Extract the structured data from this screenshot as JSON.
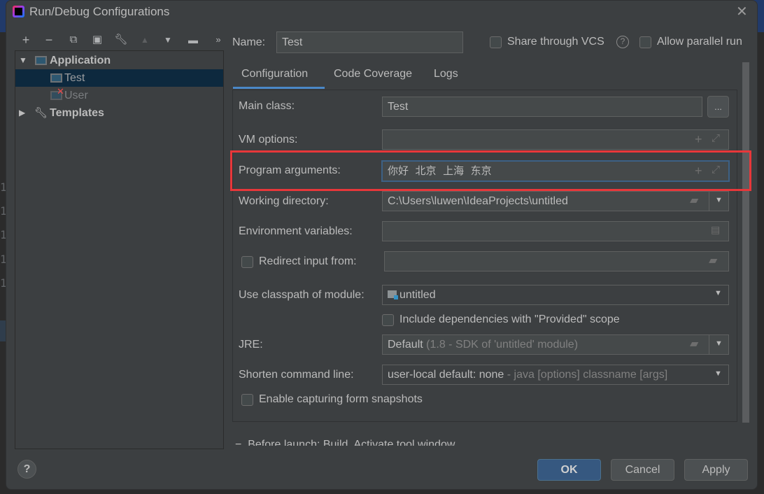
{
  "window": {
    "title": "Run/Debug Configurations"
  },
  "toolbar": {
    "icons": [
      "plus-icon",
      "minus-icon",
      "copy-icon",
      "save-icon",
      "wrench-icon",
      "arrow-up-icon",
      "arrow-down-icon",
      "folder-add-icon",
      "more-icon"
    ],
    "more": "»"
  },
  "tree": {
    "application": "Application",
    "items": [
      {
        "label": "Test",
        "selected": true
      },
      {
        "label": "User",
        "error": true
      }
    ],
    "templates": "Templates"
  },
  "name": {
    "label": "Name:",
    "value": "Test"
  },
  "share_vcs": {
    "label": "Share through VCS",
    "checked": false
  },
  "allow_parallel": {
    "label": "Allow parallel run",
    "checked": false
  },
  "tabs": [
    {
      "label": "Configuration",
      "active": true
    },
    {
      "label": "Code Coverage"
    },
    {
      "label": "Logs"
    }
  ],
  "form": {
    "main_class": {
      "label": "Main class:",
      "value": "Test",
      "browse": "..."
    },
    "vm_options": {
      "label": "VM options:",
      "value": ""
    },
    "program_arguments": {
      "label": "Program arguments:",
      "value": "你好  北京  上海  东京"
    },
    "working_directory": {
      "label": "Working directory:",
      "value": "C:\\Users\\luwen\\IdeaProjects\\untitled"
    },
    "environment_variables": {
      "label": "Environment variables:",
      "value": ""
    },
    "redirect_input": {
      "label": "Redirect input from:",
      "checked": false,
      "value": ""
    },
    "classpath_module": {
      "label": "Use classpath of module:",
      "value": "untitled"
    },
    "include_provided": {
      "label": "Include dependencies with \"Provided\" scope",
      "checked": false
    },
    "jre": {
      "label": "JRE:",
      "value": "Default",
      "hint": "(1.8 - SDK of 'untitled' module)"
    },
    "shorten_command_line": {
      "label": "Shorten command line:",
      "value": "user-local default: none",
      "hint": "- java [options] classname [args]"
    },
    "capture_snapshots": {
      "label": "Enable capturing form snapshots",
      "checked": false
    }
  },
  "before_launch": "Before launch: Build, Activate tool window",
  "buttons": {
    "ok": "OK",
    "cancel": "Cancel",
    "apply": "Apply"
  },
  "colors": {
    "highlight_box": "#e8373a",
    "focus_border": "#3d6185",
    "selection": "#0d293e",
    "ok_button": "#365880"
  }
}
